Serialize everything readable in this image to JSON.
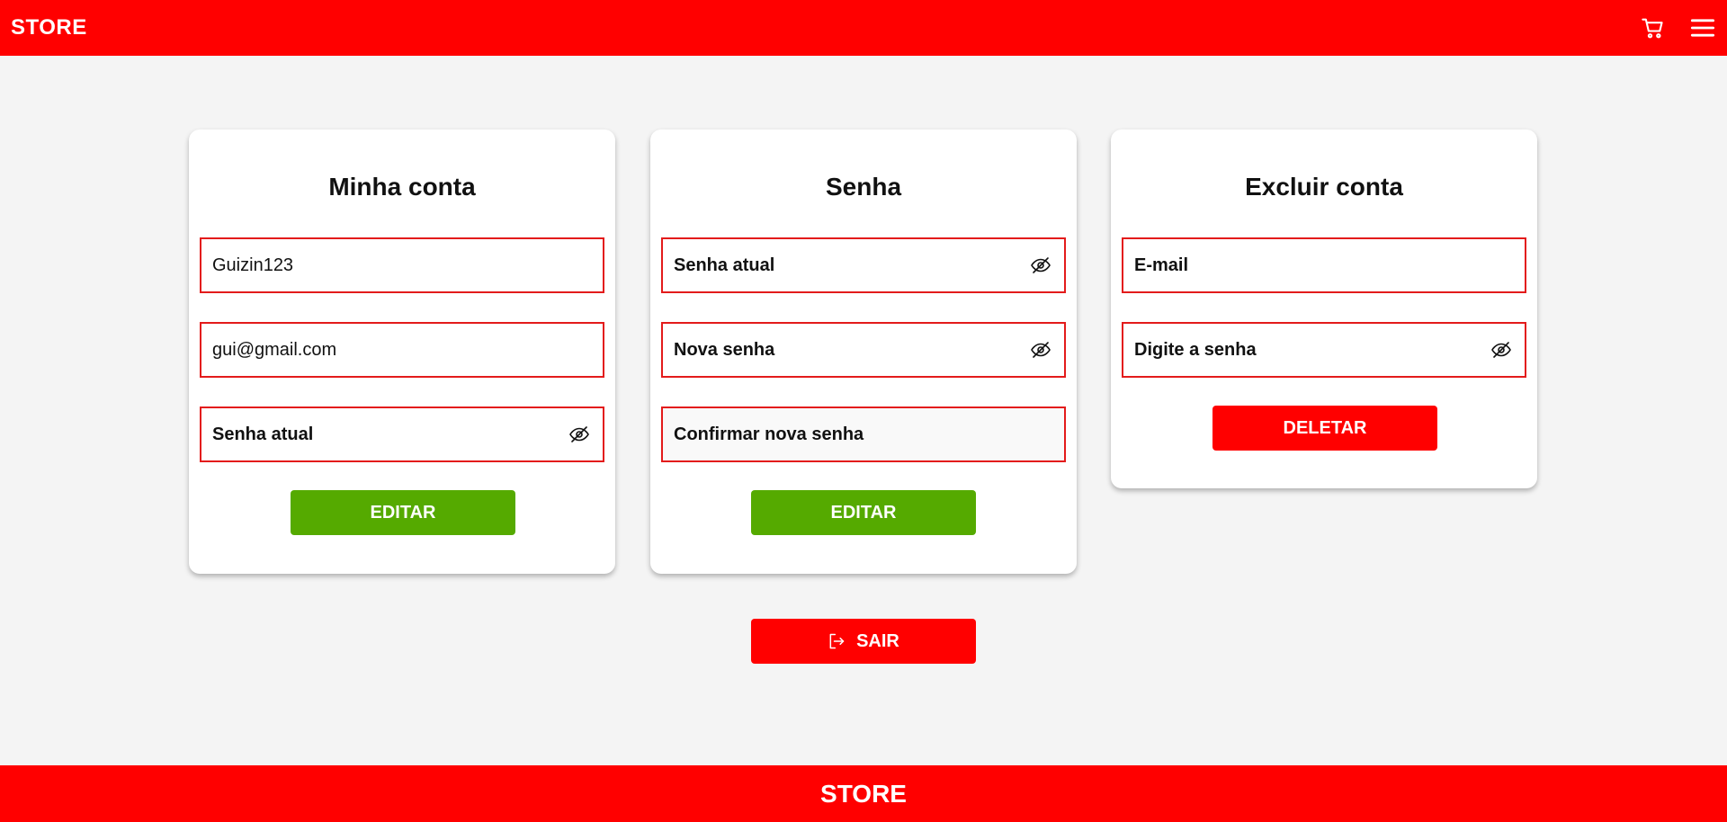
{
  "header": {
    "brand": "STORE",
    "cart_icon": "cart-icon",
    "menu_icon": "hamburger-menu-icon",
    "background_color": "#ff0000"
  },
  "account_card": {
    "title": "Minha conta",
    "username_value": "Guizin123",
    "email_value": "gui@gmail.com",
    "current_password_placeholder": "Senha atual",
    "edit_label": "EDITAR"
  },
  "password_card": {
    "title": "Senha",
    "current_password_placeholder": "Senha atual",
    "new_password_placeholder": "Nova senha",
    "confirm_password_placeholder": "Confirmar nova senha",
    "edit_label": "EDITAR"
  },
  "delete_card": {
    "title": "Excluir conta",
    "email_placeholder": "E-mail",
    "password_placeholder": "Digite a senha",
    "delete_label": "DELETAR"
  },
  "logout": {
    "label": "SAIR",
    "icon": "logout-icon"
  },
  "footer": {
    "brand": "STORE"
  },
  "colors": {
    "primary_red": "#ff0000",
    "field_border": "#e31b1b",
    "edit_green": "#55aa00",
    "page_background": "#f4f4f4"
  }
}
